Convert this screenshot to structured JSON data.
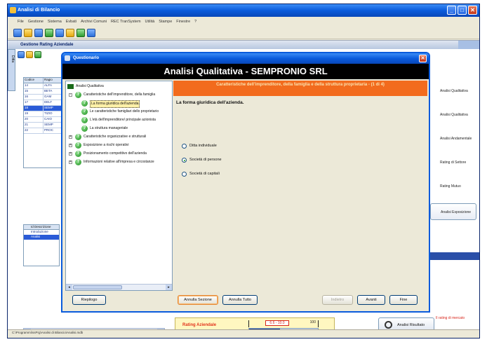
{
  "app": {
    "title": "Analisi di Bilancio"
  },
  "menu": [
    "File",
    "Gestione",
    "Sistema",
    "Evbati",
    "Archivi Comuni",
    "REC TranSystem",
    "Utilità",
    "Stampe",
    "Finestre",
    "?"
  ],
  "mdi": {
    "title": "Gestione Rating Aziendale",
    "side_tab": "Ditta"
  },
  "background_table": {
    "columns": [
      "Codice",
      "Ragio"
    ],
    "rows": [
      [
        "14",
        "ALFA"
      ],
      [
        "15",
        "BETA"
      ],
      [
        "16",
        "GAM"
      ],
      [
        "17",
        "DELT"
      ],
      [
        "18",
        "SEMP"
      ],
      [
        "19",
        "TIZIO"
      ],
      [
        "20",
        "CAIO"
      ],
      [
        "21",
        "SEMP"
      ],
      [
        "22",
        "PROC"
      ]
    ],
    "selected_row": 4
  },
  "background_list2": {
    "header": "Id  Descrizione",
    "rows": [
      "Introduzione",
      "Analisi"
    ],
    "selected_row": 1
  },
  "right_panel": {
    "buttons": [
      "Analisi Qualitativa",
      "Analisi Qualitativa",
      "Analisi Andamentale",
      "Rating di Settore",
      "Rating Mutuo",
      "Analisi Esposizione"
    ],
    "red_note": "Il rating di mercato"
  },
  "rating": {
    "label": "Rating Aziendale",
    "value": "6.6 - 10.0",
    "max": "100",
    "fill_fraction": 0.45
  },
  "risultato_button": "Analisi Risultato",
  "statusbar": "C:\\Programmi\\ssPrg\\Analisi di Bilancio\\Analisi.mdb",
  "dialog": {
    "title": "Questionario",
    "header": "Analisi Qualitativa - SEMPRONIO SRL",
    "tree": {
      "root": "Analisi Qualitativa",
      "items": [
        {
          "label": "Caratteristiche dell'imprenditore, della famiglia",
          "level": 1,
          "expander": "-"
        },
        {
          "label": "La forma giuridica dell'azienda",
          "level": 2,
          "selected": true
        },
        {
          "label": "Le caratteristiche famigliari dello proprietario",
          "level": 2
        },
        {
          "label": "L'età dell'imprenditore/ principale azionista",
          "level": 2
        },
        {
          "label": "La struttura manageriale",
          "level": 2
        },
        {
          "label": "Caratteristiche organizzative e strutturali",
          "level": 1,
          "expander": "+"
        },
        {
          "label": "Esposizione a rischi operativi",
          "level": 1,
          "expander": "+"
        },
        {
          "label": "Posizionamento competitivo dell'azienda",
          "level": 1,
          "expander": "+"
        },
        {
          "label": "Informazioni relative all'impresa e circostanze",
          "level": 1,
          "expander": "+"
        }
      ]
    },
    "question_header": "Caratteristiche dell'imprenditore, della famiglia e della struttura proprietaria - (1 di 4)",
    "question": "La forma giuridica dell'azienda.",
    "options": [
      {
        "label": "Ditta individuale",
        "selected": false
      },
      {
        "label": "Società di persone",
        "selected": true
      },
      {
        "label": "Società di capitali",
        "selected": false
      }
    ],
    "buttons": {
      "riepilogo": "Riepilogo",
      "annulla_sezione": "Annulla Sezione",
      "annulla_tutto": "Annulla Tutto",
      "indietro": "Indietro",
      "avanti": "Avanti",
      "fine": "Fine"
    }
  }
}
